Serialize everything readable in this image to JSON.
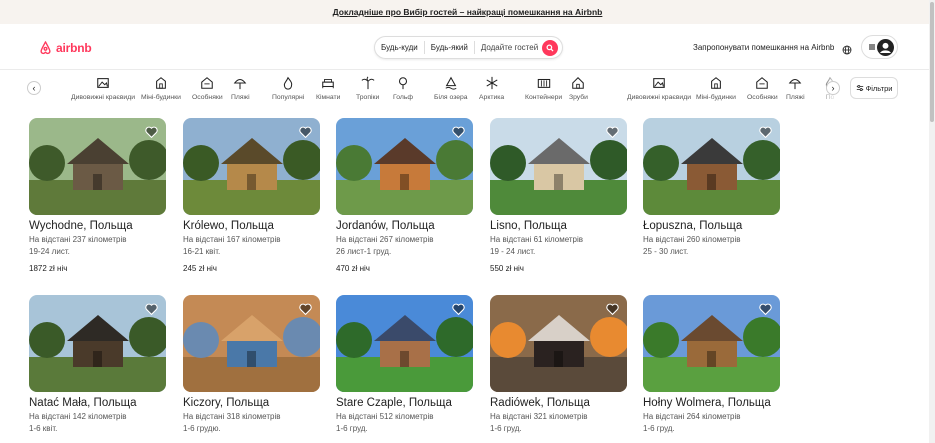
{
  "banner": {
    "text": "Докладніше про Вибір гостей – найкращі помешкання на Airbnb"
  },
  "header": {
    "logo_text": "airbnb",
    "search": {
      "where": "Будь-куди",
      "when": "Будь-який",
      "guests": "Додайте гостей"
    },
    "host_link": "Запропонувати помешкання на Airbnb"
  },
  "categories": [
    {
      "label": "Дивовижні краєвиди",
      "icon": "landscape-icon"
    },
    {
      "label": "Міні-будинки",
      "icon": "tiny-home-icon"
    },
    {
      "label": "Особняки",
      "icon": "mansion-icon"
    },
    {
      "label": "Пляжі",
      "icon": "beach-icon"
    },
    {
      "label": "Популярні",
      "icon": "trending-icon"
    },
    {
      "label": "Кімнати",
      "icon": "room-icon"
    },
    {
      "label": "Тропіки",
      "icon": "tropical-icon"
    },
    {
      "label": "Гольф",
      "icon": "golf-icon"
    },
    {
      "label": "Біля озера",
      "icon": "lake-icon"
    },
    {
      "label": "Арктика",
      "icon": "arctic-icon"
    },
    {
      "label": "Контейнери",
      "icon": "container-icon"
    },
    {
      "label": "Зруби",
      "icon": "cabin-icon"
    },
    {
      "label": "Дивовижні краєвиди",
      "icon": "landscape-icon"
    },
    {
      "label": "Міні-будинки",
      "icon": "tiny-home-icon"
    },
    {
      "label": "Особняки",
      "icon": "mansion-icon"
    },
    {
      "label": "Пляжі",
      "icon": "beach-icon"
    },
    {
      "label": "По",
      "icon": "trending-icon"
    }
  ],
  "filters_label": "Фільтри",
  "listings": [
    {
      "title": "Wychodne, Польща",
      "distance": "На відстані 237 кілометрів",
      "dates": "19-24 лист.",
      "price": "1872 zł ніч"
    },
    {
      "title": "Królewo, Польща",
      "distance": "На відстані 167 кілометрів",
      "dates": "16-21 квіт.",
      "price": "245 zł ніч"
    },
    {
      "title": "Jordanów, Польща",
      "distance": "На відстані 267 кілометрів",
      "dates": "26 лист-1 груд.",
      "price": "470 zł ніч"
    },
    {
      "title": "Lisno, Польща",
      "distance": "На відстані 61 кілометрів",
      "dates": "19 - 24 лист.",
      "price": "550 zł ніч"
    },
    {
      "title": "Łopuszna, Польща",
      "distance": "На відстані 260 кілометрів",
      "dates": "25 - 30 лист.",
      "price": ""
    },
    {
      "title": "Natać Mała, Польща",
      "distance": "На відстані 142 кілометрів",
      "dates": "1-6 квіт.",
      "price": ""
    },
    {
      "title": "Kiczory, Польща",
      "distance": "На відстані 318 кілометрів",
      "dates": "1-6 грудю.",
      "price": ""
    },
    {
      "title": "Stare Czaple, Польща",
      "distance": "На відстані 512 кілометрів",
      "dates": "1-6 груд.",
      "price": ""
    },
    {
      "title": "Radiówek, Польща",
      "distance": "На відстані 321 кілометрів",
      "dates": "1-6 груд.",
      "price": ""
    },
    {
      "title": "Hołny Wolmera, Польща",
      "distance": "На відстані 264 кілометрів",
      "dates": "1-6 груд.",
      "price": ""
    }
  ],
  "colors": {
    "brand": "#ff385c",
    "banner_bg": "#f7f3ef",
    "text": "#222222",
    "muted": "#555555"
  }
}
